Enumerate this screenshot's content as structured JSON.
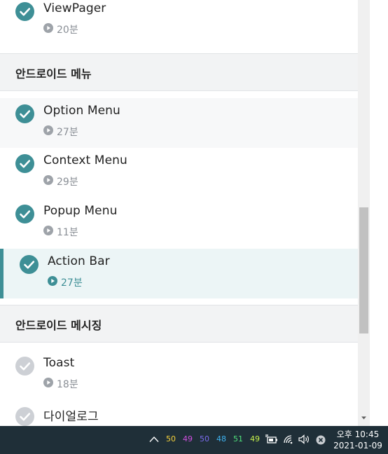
{
  "lessons": [
    {
      "title": "ViewPager",
      "duration": "20분",
      "status": "done"
    },
    {
      "title": "Option Menu",
      "duration": "27분",
      "status": "done"
    },
    {
      "title": "Context Menu",
      "duration": "29분",
      "status": "done"
    },
    {
      "title": "Popup Menu",
      "duration": "11분",
      "status": "done"
    },
    {
      "title": "Action Bar",
      "duration": "27분",
      "status": "current"
    },
    {
      "title": "Toast",
      "duration": "18분",
      "status": "todo"
    },
    {
      "title": "다이얼로그",
      "duration": "",
      "status": "todo"
    }
  ],
  "sections": [
    {
      "title": "안드로이드 메뉴"
    },
    {
      "title": "안드로이드 메시징"
    }
  ],
  "taskbar": {
    "counters": [
      {
        "value": "50",
        "color": "#f5d13b"
      },
      {
        "value": "49",
        "color": "#d04fe0"
      },
      {
        "value": "50",
        "color": "#7b6cf0"
      },
      {
        "value": "48",
        "color": "#3fb4f2"
      },
      {
        "value": "51",
        "color": "#4fe07b"
      },
      {
        "value": "49",
        "color": "#c6f24a"
      }
    ],
    "time": "오후 10:45",
    "date": "2021-01-09"
  },
  "colors": {
    "accent": "#3e8f96",
    "pending": "#cdd0d5",
    "active_bg": "#ecf5f6",
    "section_bg": "#f2f3f4"
  }
}
